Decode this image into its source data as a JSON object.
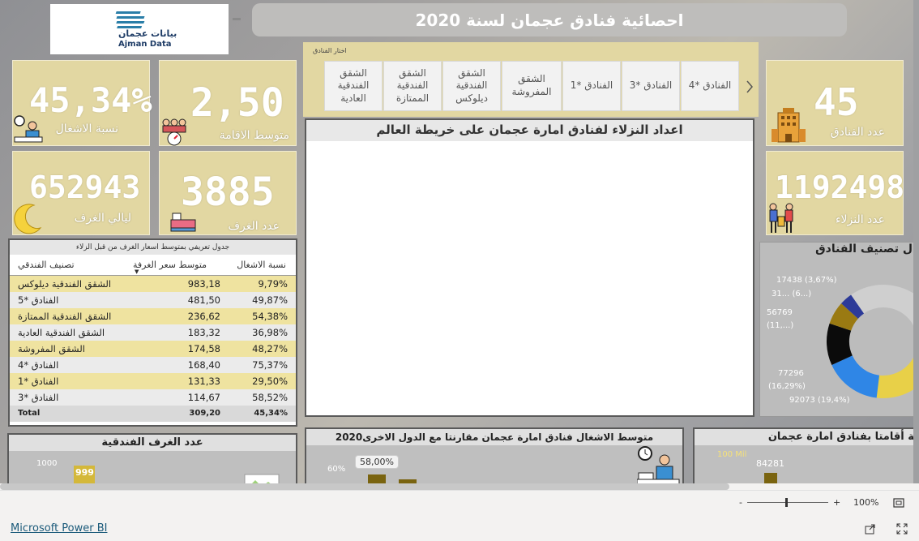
{
  "header": {
    "logo_text_ar": "بيانات عجمان",
    "logo_text_en": "Ajman Data",
    "title": "احصائية فنادق عجمان لسنة 2020"
  },
  "kpis": {
    "occupancy": {
      "value": "45,34%",
      "label": "نسبة الاشغال",
      "icon": "person-at-desk-icon"
    },
    "avg_stay": {
      "value": "2,50",
      "label": "متوسط الاقامة",
      "icon": "group-clock-icon"
    },
    "hotels": {
      "value": "45",
      "label": "عدد الفنادق",
      "icon": "hotel-building-icon"
    },
    "room_nights": {
      "value": "652943",
      "label": "ليالي الغرف",
      "icon": "moon-icon"
    },
    "rooms": {
      "value": "3885",
      "label": "عدد الغرف",
      "icon": "bed-icon"
    },
    "guests": {
      "value": "1192498",
      "label": "عدد النزلاء",
      "icon": "travelers-icon"
    }
  },
  "slicer": {
    "title": "اختار الفنادق",
    "options": [
      "الفنادق *4",
      "الفنادق *3",
      "الفنادق *1",
      "الشقق المفروشة",
      "الشقق الفندقية ديلوكس",
      "الشقق الفندقية الممتازة",
      "الشقق الفندقية العادية"
    ],
    "next_icon": "chevron-right-icon"
  },
  "map": {
    "title": "اعداد النزلاء لفنادق امارة عجمان على خريطة العالم"
  },
  "table": {
    "caption": "جدول تعريفي بمتوسط اسعار الغرف من قبل الزلاء",
    "headers": [
      "تصنيف الفندقي",
      "متوسط سعر الغرفة",
      "نسبة الاشغال"
    ],
    "rows": [
      [
        "الشقق الفندقية ديلوكس",
        "983,18",
        "9,79%"
      ],
      [
        "الفنادق *5",
        "481,50",
        "49,87%"
      ],
      [
        "الشقق الفندقية الممتازة",
        "236,62",
        "54,38%"
      ],
      [
        "الشقق الفندقية العادية",
        "183,32",
        "36,98%"
      ],
      [
        "الشقق المفروشة",
        "174,58",
        "48,27%"
      ],
      [
        "الفنادق *4",
        "168,40",
        "75,37%"
      ],
      [
        "الفنادق *1",
        "131,33",
        "29,50%"
      ],
      [
        "الفنادق *3",
        "114,67",
        "58,52%"
      ]
    ],
    "total": [
      "Total",
      "309,20",
      "45,34%"
    ]
  },
  "donut": {
    "title": "ل تصنيف الفنادق",
    "labels": [
      "17438 (3,67%)",
      "31... (6...)",
      "56769",
      "(11,...)",
      "77296",
      "(16,29%)",
      "92073 (19,4%)"
    ]
  },
  "chart_data": [
    {
      "type": "pie",
      "title": "ل تصنيف الفنادق",
      "values": [
        92073,
        77296,
        56769,
        31000,
        17438,
        200000
      ],
      "colors": [
        "#e8d048",
        "#2f86e6",
        "#0b0b0b",
        "#9a7a12",
        "#2c3a98",
        "#cfcfcf"
      ],
      "data_labels": [
        "92073 (19,4%)",
        "77296 (16,29%)",
        "56769 (11,...)",
        "31... (6...)",
        "17438 (3,67%)"
      ]
    },
    {
      "type": "bar",
      "title": "عدد الغرف الفندقية",
      "ytick": "1000",
      "values": [
        999
      ],
      "data_labels": [
        "999"
      ]
    },
    {
      "type": "bar",
      "title": "متوسط الاشغال فنادق امارة عجمان مقارنتا مع الدول الاخرى2020",
      "ytick": "60%",
      "data_labels": [
        "58,00%"
      ]
    },
    {
      "type": "bar",
      "title": "ية أقامتا بفنادق امارة عجمان",
      "ytick": "100 Mil",
      "data_labels": [
        "84281"
      ]
    }
  ],
  "footer": {
    "zoom_minus": "-",
    "zoom_plus": "+",
    "zoom_level": "100%",
    "brand": "Microsoft Power BI"
  }
}
